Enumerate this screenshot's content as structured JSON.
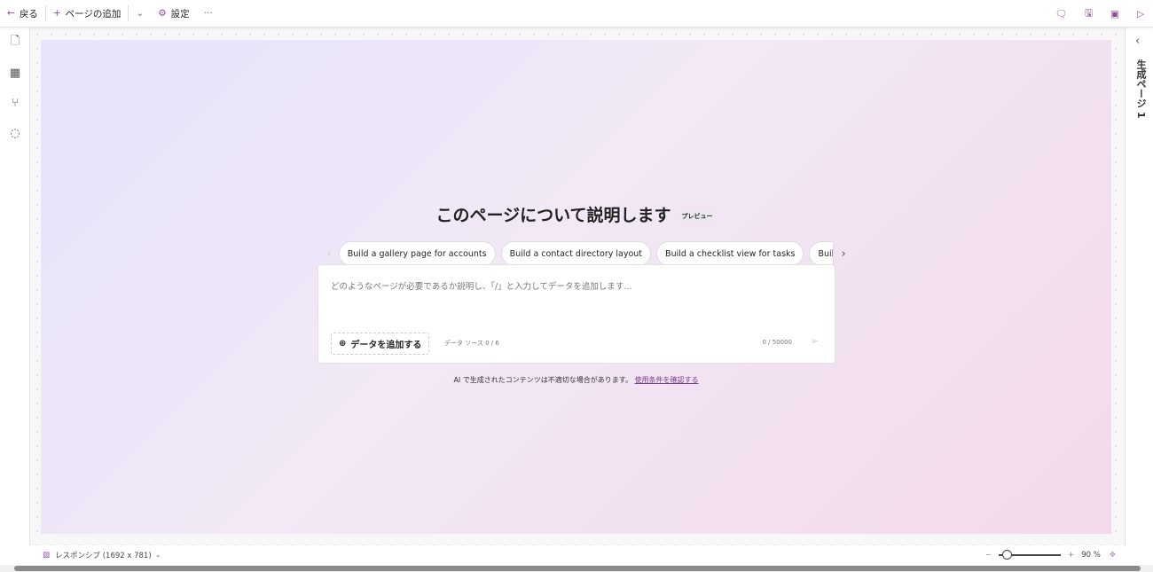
{
  "toolbar": {
    "back": "戻る",
    "add_page": "ページの追加",
    "settings": "設定",
    "more": "···"
  },
  "right_panel": {
    "title": "生成ページ 1"
  },
  "main": {
    "title": "このページについて説明します",
    "badge": "プレビュー",
    "suggestions": [
      "Build a gallery page for accounts",
      "Build a contact directory layout",
      "Build a checklist view for tasks",
      "Build ."
    ],
    "placeholder": "どのようなページが必要であるか説明し、「/」と入力してデータを追加します...",
    "add_data": "データを追加する",
    "data_sources": "データ ソース 0 / 6",
    "char_count": "0 / 50000",
    "disclaimer": "AI で生成されたコンテンツは不適切な場合があります。",
    "terms_link": "使用条件を確認する"
  },
  "bottom": {
    "layout": "レスポンシブ (1692 x 781)",
    "zoom": "90 %",
    "zoom_value": 90
  },
  "colors": {
    "accent": "#8a4b9f"
  }
}
